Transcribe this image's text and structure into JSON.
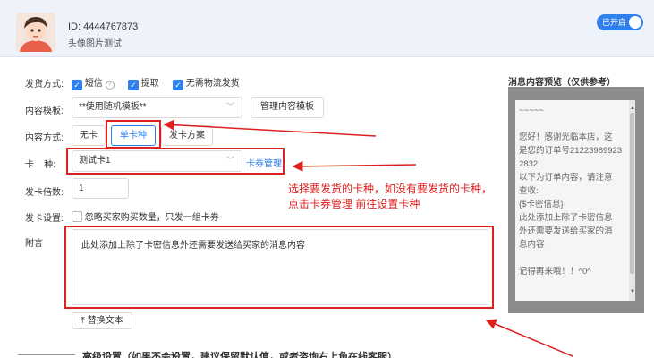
{
  "header": {
    "id_text": "ID: 4444767873",
    "subtitle": "头像图片测试",
    "toggle_label": "已开启"
  },
  "form": {
    "delivery": {
      "label": "发货方式:",
      "options": [
        {
          "label": "短信",
          "checked": true
        },
        {
          "label": "提取",
          "checked": true
        },
        {
          "label": "无需物流发货",
          "checked": true
        }
      ]
    },
    "template": {
      "label": "内容模板:",
      "value": "**使用随机模板**",
      "manage_button": "管理内容模板"
    },
    "content_mode": {
      "label": "内容方式:",
      "options": [
        "无卡",
        "单卡种",
        "发卡方案"
      ],
      "selected": "单卡种"
    },
    "card_type": {
      "label": "卡    种:",
      "value": "测试卡1",
      "manage_link": "卡券管理"
    },
    "multiplier": {
      "label": "发卡倍数:",
      "value": "1"
    },
    "card_setting": {
      "label": "发卡设置:",
      "option": "忽略买家购买数量，只发一组卡券",
      "checked": false
    },
    "note": {
      "label": "附言",
      "value": "此处添加上除了卡密信息外还需要发送给买家的消息内容"
    },
    "replace_button": "替换文本"
  },
  "annotation": {
    "line1": "选择要发货的卡种，如没有要发货的卡种，",
    "line2": "点击卡券管理 前往设置卡种",
    "color": "#e02020"
  },
  "preview": {
    "title": "消息内容预览（仅供参考）",
    "lines": [
      "~~~~~",
      "",
      "您好！感谢光临本店，这",
      "是您的订单号21223989923",
      "2832",
      "以下为订单内容，请注意",
      "查收:",
      "{$卡密信息}",
      "此处添加上除了卡密信息",
      "外还需要发送给买家的消",
      "息内容",
      "",
      "记得再来哦！！^0^"
    ]
  },
  "advanced": {
    "title": "高级设置（如果不会设置，建议保留默认值，或者咨询右上角在线客服）"
  },
  "colors": {
    "accent": "#2f80ed",
    "header_bg": "#eef3fb",
    "preview_frame": "#8c8c8c"
  }
}
